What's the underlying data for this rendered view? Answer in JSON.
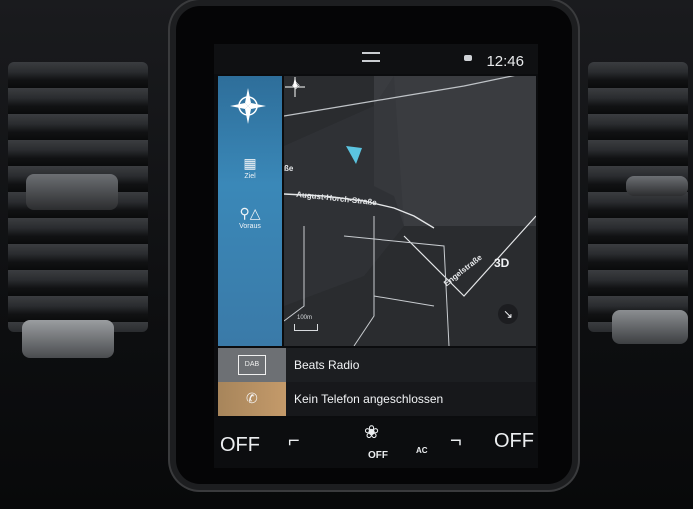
{
  "status_bar": {
    "time": "12:46"
  },
  "sidebar": {
    "items": [
      {
        "label": "Ziel",
        "icon": "checkered-flag-icon"
      },
      {
        "label": "Voraus",
        "icon": "pin-warning-icon"
      }
    ]
  },
  "map": {
    "streets": [
      "August-Horch-Straße",
      "Engelstraße",
      "ße"
    ],
    "view_button": "3D",
    "scale": "100m"
  },
  "tiles": {
    "radio": {
      "badge": "DAB",
      "label": "Beats Radio"
    },
    "phone": {
      "label": "Kein Telefon angeschlossen"
    }
  },
  "climate": {
    "left_temp": "OFF",
    "right_temp": "OFF",
    "fan": "OFF",
    "ac": "AC"
  },
  "colors": {
    "sidebar_accent": "#3a88b8",
    "map_bg": "#2a2c2f",
    "vehicle_arrow": "#5bc4e0"
  }
}
